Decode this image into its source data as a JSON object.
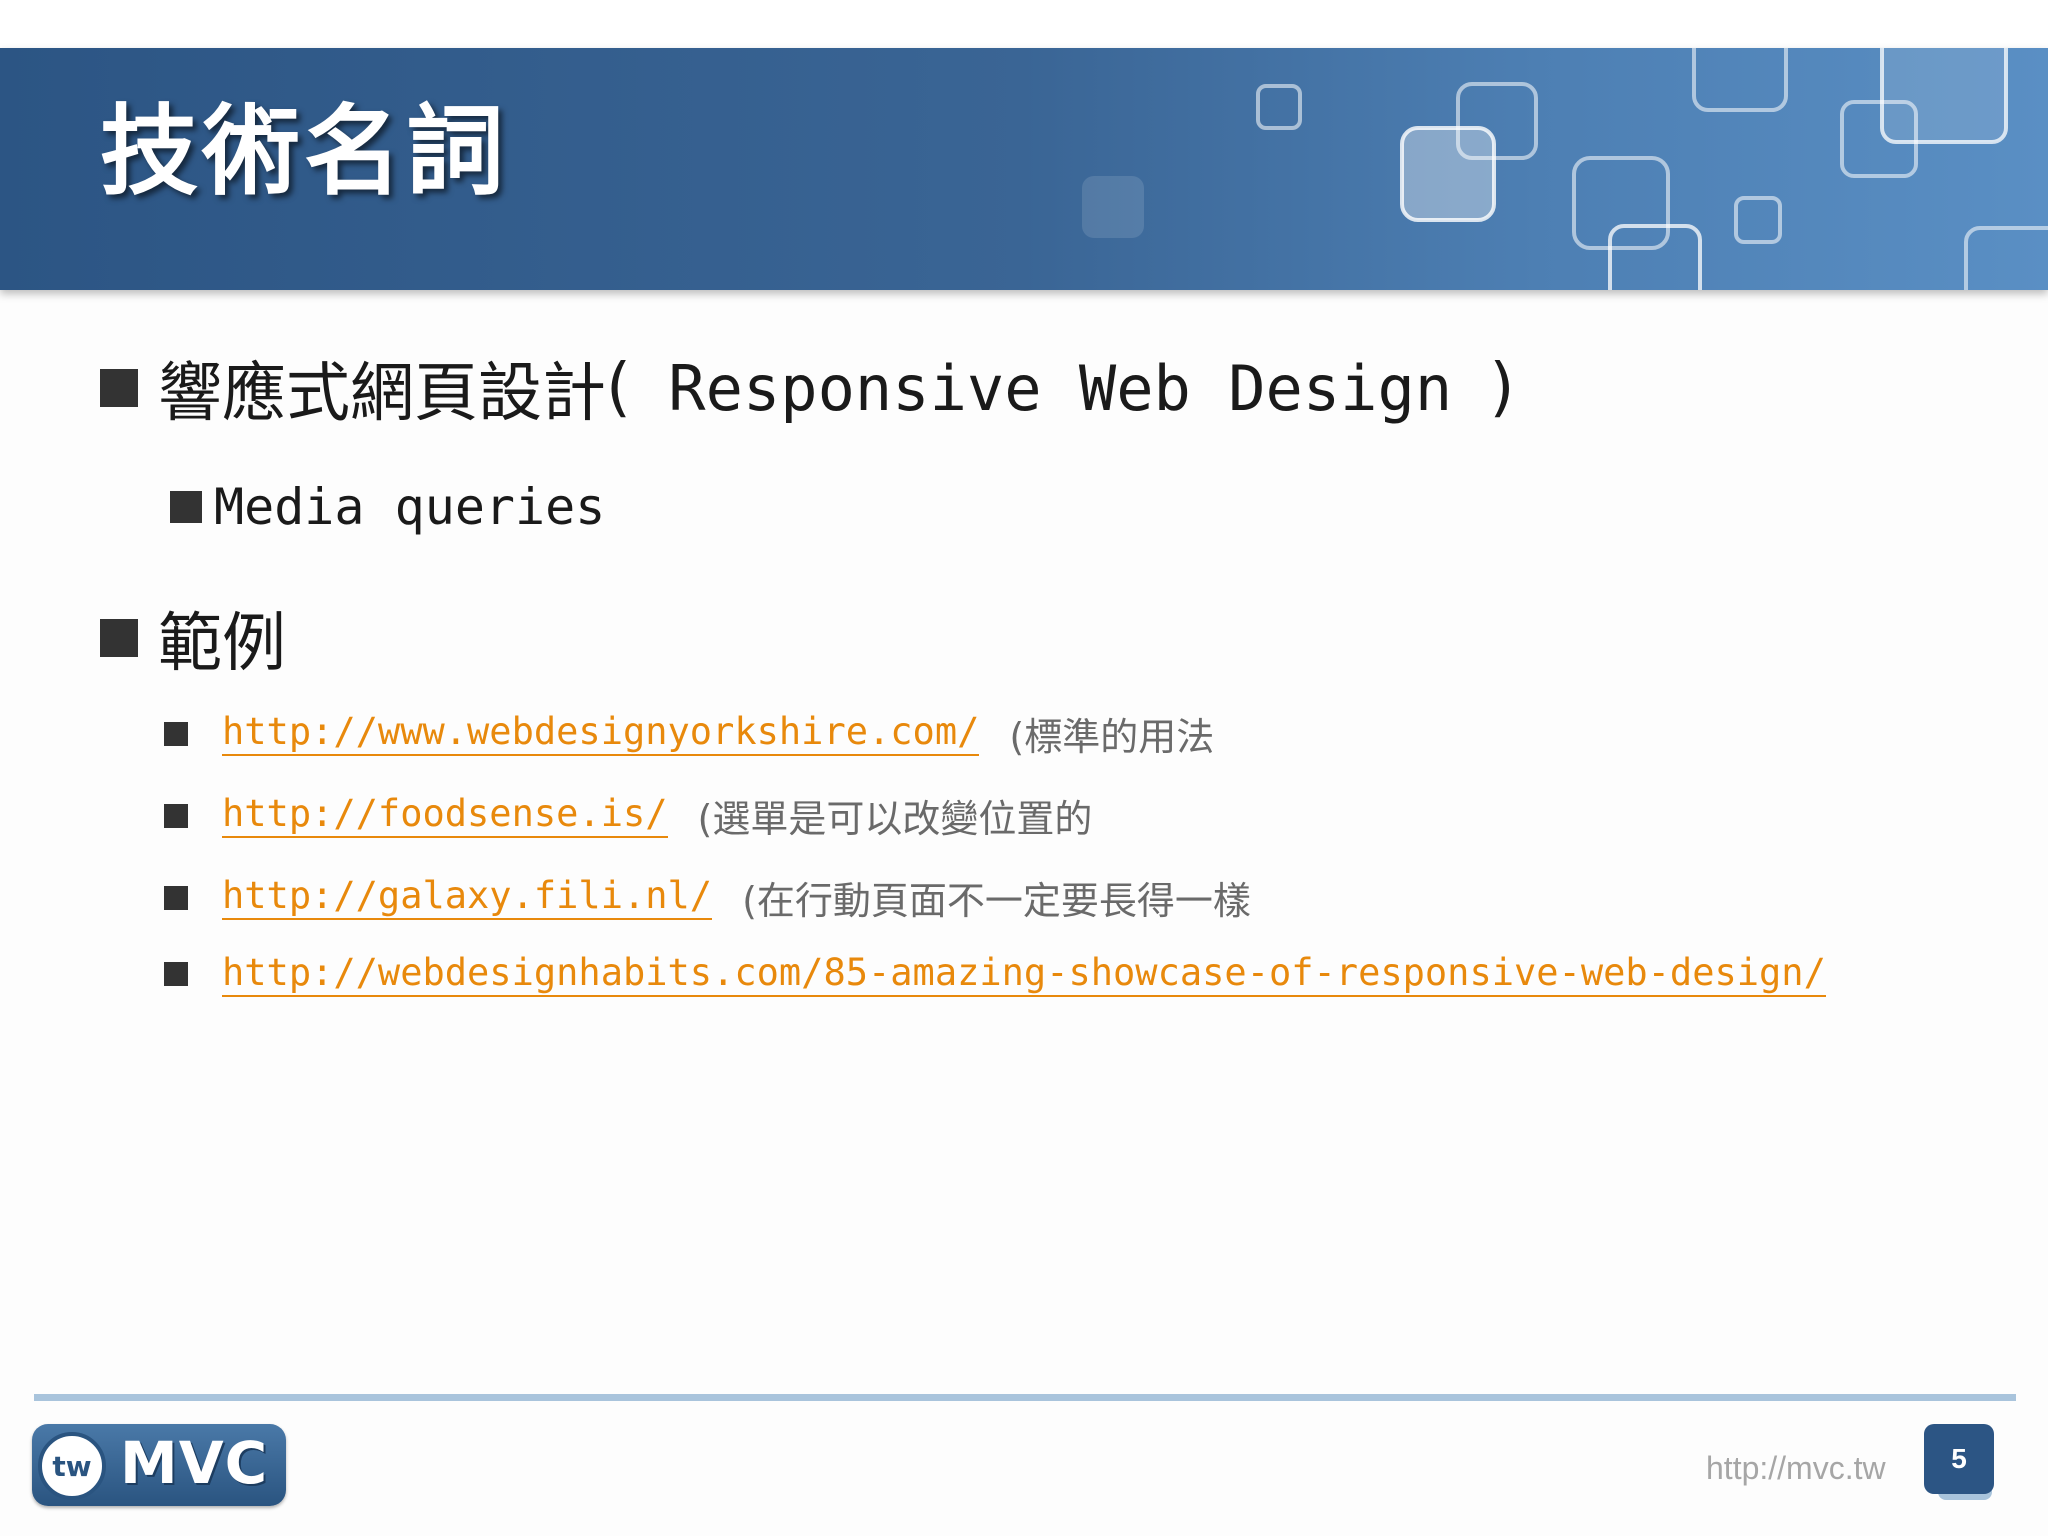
{
  "slide": {
    "title": "技術名詞",
    "bullets": {
      "rwd_zh": "響應式網頁設計",
      "rwd_paren_open": "(",
      "rwd_en": " Responsive Web Design ",
      "rwd_paren_close": ")",
      "media_queries": "Media queries",
      "examples": "範例"
    },
    "links": [
      {
        "url": "http://www.webdesignyorkshire.com/",
        "note": "(標準的用法"
      },
      {
        "url": "http://foodsense.is/",
        "note": "(選單是可以改變位置的"
      },
      {
        "url": "http://galaxy.fili.nl/",
        "note": "(在行動頁面不一定要長得一樣"
      },
      {
        "url": "http://webdesignhabits.com/85-amazing-showcase-of-responsive-web-design/",
        "note": ""
      }
    ]
  },
  "footer": {
    "logo_badge": "tw",
    "logo_text": "MVC",
    "url": "http://mvc.tw",
    "page_number": "5"
  },
  "colors": {
    "banner": "#2c5584",
    "link": "#e8890c",
    "note": "#6a6a6a",
    "footer_line": "#a9c4dc"
  },
  "icons": {
    "bullet": "square-bullet-icon",
    "logo": "tw-mvc-logo"
  }
}
